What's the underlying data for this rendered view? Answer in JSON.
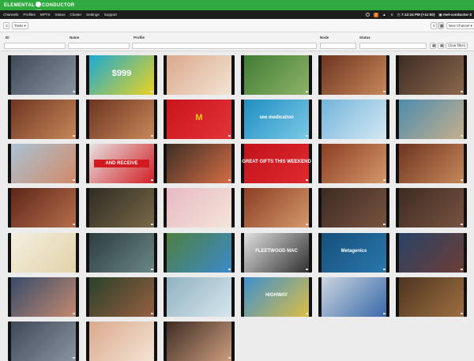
{
  "app": {
    "logo_text": "ELEMENTAL",
    "logo_text2": "CONDUCTOR",
    "logo_sub": "LIVE"
  },
  "nav": {
    "items": [
      "Channels",
      "Profiles",
      "MPTS",
      "Status",
      "Cluster",
      "Settings",
      "Support"
    ],
    "alerts_count": "3",
    "warnings": "0",
    "time": "7:12:24 PM (+11:00)",
    "server": "mel-conductor-3"
  },
  "toolbar": {
    "tasks_label": "Tasks",
    "new_channel_label": "New Channel"
  },
  "filters": {
    "id_label": "ID",
    "name_label": "Name",
    "profile_label": "Profile",
    "node_label": "Node",
    "status_label": "Status",
    "clear_label": "Clear filters"
  },
  "thumbnails": [
    {
      "name": "snow-ski",
      "colors": [
        "#3c4654",
        "#8d96a4"
      ]
    },
    {
      "name": "lotto-ad",
      "colors": [
        "#15a8d8",
        "#f1d41a"
      ],
      "caption": "$999"
    },
    {
      "name": "hands-cooking",
      "colors": [
        "#d9a78a",
        "#f4e6d6"
      ]
    },
    {
      "name": "horse-racing",
      "colors": [
        "#3f7a32",
        "#8fb56a"
      ]
    },
    {
      "name": "crowd-arena",
      "colors": [
        "#6b3320",
        "#c98a5a"
      ]
    },
    {
      "name": "tv-studio",
      "colors": [
        "#3a2a24",
        "#8e6a4c"
      ]
    },
    {
      "name": "crowd-arena",
      "colors": [
        "#6b3320",
        "#c98a5a"
      ]
    },
    {
      "name": "crowd-arena",
      "colors": [
        "#6b3320",
        "#c98a5a"
      ]
    },
    {
      "name": "mcdonalds-ad",
      "colors": [
        "#c8141a",
        "#e3353a"
      ],
      "caption": "M"
    },
    {
      "name": "medication-ad",
      "colors": [
        "#1c8cc2",
        "#7ecbe6"
      ],
      "caption": "see medication"
    },
    {
      "name": "dancer",
      "colors": [
        "#6fb2da",
        "#d7eaf4"
      ]
    },
    {
      "name": "woman-outdoors",
      "colors": [
        "#4a8bb0",
        "#c9b08a"
      ]
    },
    {
      "name": "news-interview",
      "colors": [
        "#a9c4d8",
        "#d38865"
      ]
    },
    {
      "name": "season-to-give",
      "colors": [
        "#e8e8e8",
        "#d11a1f"
      ],
      "caption": "AND RECEIVE"
    },
    {
      "name": "peaches",
      "colors": [
        "#3a2d24",
        "#d86f45"
      ]
    },
    {
      "name": "great-gifts",
      "colors": [
        "#c1121a",
        "#e02a30"
      ],
      "caption": "GREAT GIFTS THIS WEEKEND"
    },
    {
      "name": "woman-portrait",
      "colors": [
        "#8a3c22",
        "#d69a6c"
      ]
    },
    {
      "name": "crowd-arena",
      "colors": [
        "#6b3320",
        "#c98a5a"
      ]
    },
    {
      "name": "woman-portrait",
      "colors": [
        "#5a2418",
        "#b8704c"
      ]
    },
    {
      "name": "bar-crowd",
      "colors": [
        "#2c2a22",
        "#7a6a48"
      ]
    },
    {
      "name": "heart-card",
      "colors": [
        "#e7b8c4",
        "#f4e6d8"
      ]
    },
    {
      "name": "woman-portrait",
      "colors": [
        "#8a3c22",
        "#d69a6c"
      ]
    },
    {
      "name": "man-suit",
      "colors": [
        "#3a2a22",
        "#7a5440"
      ]
    },
    {
      "name": "man-suit",
      "colors": [
        "#3a2a22",
        "#7a5440"
      ]
    },
    {
      "name": "mcdonalds-drinks",
      "colors": [
        "#f3efe0",
        "#e2d2a8"
      ]
    },
    {
      "name": "man-closeup",
      "colors": [
        "#2a3a3e",
        "#6c8a86"
      ]
    },
    {
      "name": "blue-car",
      "colors": [
        "#4f7f3c",
        "#3b8ad0"
      ]
    },
    {
      "name": "fleetwood-mac",
      "colors": [
        "#e6e6e6",
        "#2a2a2a"
      ],
      "caption": "FLEETWOOD MAC"
    },
    {
      "name": "metagenics",
      "colors": [
        "#164f7a",
        "#2a77ad"
      ],
      "caption": "Metagenics"
    },
    {
      "name": "man-suit-blue",
      "colors": [
        "#27436a",
        "#6e3d32"
      ]
    },
    {
      "name": "news-anchor",
      "colors": [
        "#334a6a",
        "#c88a70"
      ]
    },
    {
      "name": "christmas-party",
      "colors": [
        "#26402a",
        "#9a6040"
      ]
    },
    {
      "name": "drink-glass",
      "colors": [
        "#8fb0c0",
        "#d8e8ee"
      ]
    },
    {
      "name": "highway-ad",
      "colors": [
        "#3a8ed2",
        "#e0c040"
      ],
      "caption": "HIGHWAY"
    },
    {
      "name": "news-van",
      "colors": [
        "#d0d8e0",
        "#3466a8"
      ]
    },
    {
      "name": "blurred-scene",
      "colors": [
        "#4a3420",
        "#a07040"
      ]
    },
    {
      "name": "snow-ski",
      "colors": [
        "#3c4654",
        "#8d96a4"
      ]
    },
    {
      "name": "hands-cooking",
      "colors": [
        "#d9a78a",
        "#f4e6d6"
      ]
    },
    {
      "name": "hands-cooking",
      "colors": [
        "#3a2a22",
        "#d0a080"
      ]
    }
  ]
}
